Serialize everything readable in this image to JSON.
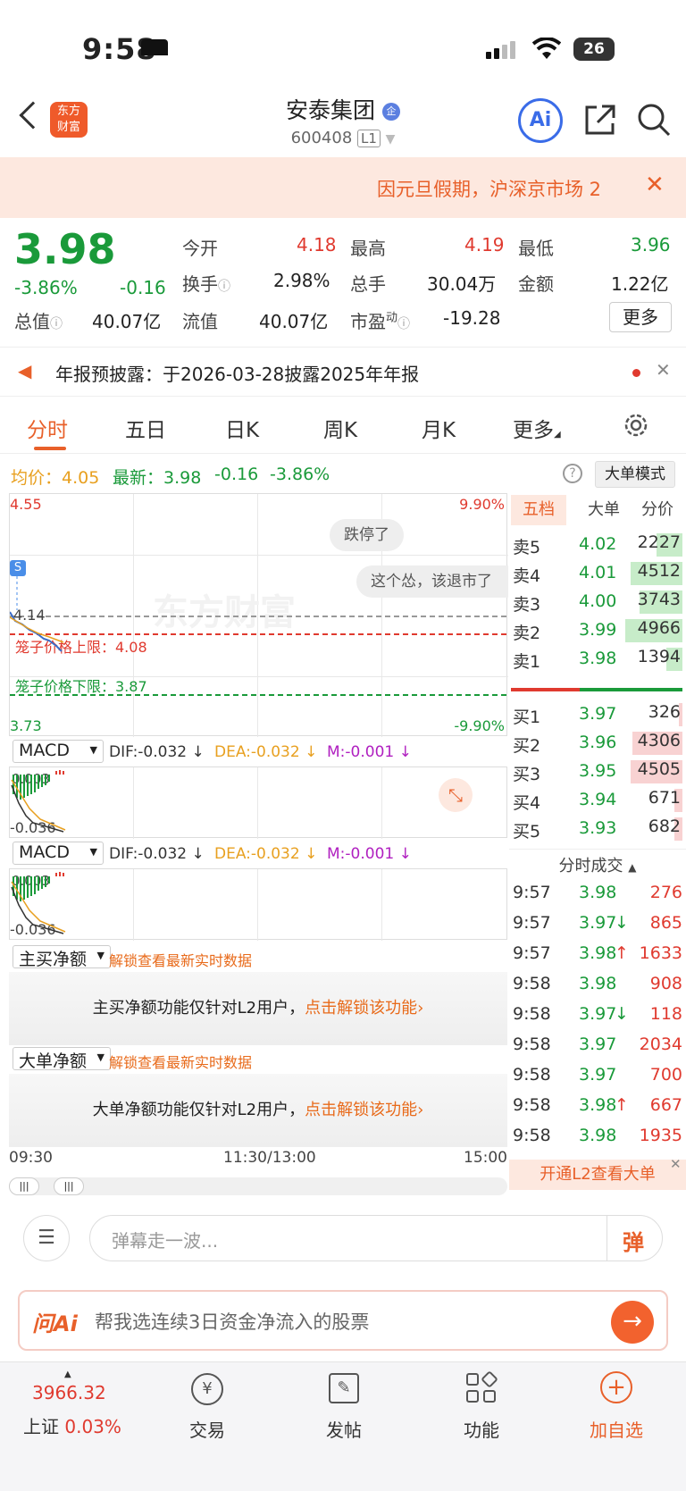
{
  "status": {
    "time": "9:58",
    "battery": "26"
  },
  "header": {
    "logo": "东方\n财富",
    "title": "安泰集团",
    "badge": "企",
    "code": "600408",
    "level": "L1",
    "ai_label": "Ai"
  },
  "notice": {
    "text": "因元旦假期，沪深京市场 2"
  },
  "quote": {
    "price": "3.98",
    "pct": "-3.86%",
    "chg": "-0.16",
    "open_label": "今开",
    "open": "4.18",
    "high_label": "最高",
    "high": "4.19",
    "low_label": "最低",
    "low": "3.96",
    "turn_label": "换手",
    "turn": "2.98%",
    "vol_label": "总手",
    "vol": "30.04万",
    "amt_label": "金额",
    "amt": "1.22亿",
    "mcap_label": "总值",
    "mcap": "40.07亿",
    "fcap_label": "流值",
    "fcap": "40.07亿",
    "pe_label": "市盈",
    "pe_sup": "动",
    "pe": "-19.28",
    "more": "更多"
  },
  "announce": {
    "text": "年报预披露：于2026-03-28披露2025年年报"
  },
  "tabs": [
    "分时",
    "五日",
    "日K",
    "周K",
    "月K",
    "更多"
  ],
  "avgline": {
    "avg_label": "均价：",
    "avg": "4.05",
    "last_label": "最新：",
    "last": "3.98",
    "chg": "-0.16",
    "pct": "-3.86%",
    "mode": "大单模式"
  },
  "chart": {
    "top": "4.55",
    "bottom": "3.73",
    "top_pct": "9.90%",
    "bottom_pct": "-9.90%",
    "ref": "4.14",
    "upper_label": "笼子价格上限：4.08",
    "lower_label": "笼子价格下限：3.87",
    "bubble1": "跌停了",
    "bubble2": "这个怂，该退市了",
    "s_mark": "S",
    "watermark": "东方财富",
    "x_labels": [
      "09:30",
      "11:30/13:00",
      "15:00"
    ]
  },
  "macd": {
    "name": "MACD",
    "dif": "DIF:-0.032 ↓",
    "dea": "DEA:-0.032 ↓",
    "m": "M:-0.001 ↓",
    "low": "-0.036",
    "hi": "0.003"
  },
  "lock1": {
    "sel": "主买净额",
    "hint": "解锁查看最新实时数据",
    "text": "主买净额功能仅针对L2用户，",
    "link": "点击解锁该功能"
  },
  "lock2": {
    "sel": "大单净额",
    "hint": "解锁查看最新实时数据",
    "text": "大单净额功能仅针对L2用户，",
    "link": "点击解锁该功能"
  },
  "side_tabs": [
    "五档",
    "大单",
    "分价"
  ],
  "sells": [
    {
      "l": "卖5",
      "p": "4.02",
      "v": "2227",
      "w": 0.45
    },
    {
      "l": "卖4",
      "p": "4.01",
      "v": "4512",
      "w": 0.9
    },
    {
      "l": "卖3",
      "p": "4.00",
      "v": "3743",
      "w": 0.75
    },
    {
      "l": "卖2",
      "p": "3.99",
      "v": "4966",
      "w": 1.0
    },
    {
      "l": "卖1",
      "p": "3.98",
      "v": "1394",
      "w": 0.28
    }
  ],
  "buys": [
    {
      "l": "买1",
      "p": "3.97",
      "v": "326",
      "w": 0.07
    },
    {
      "l": "买2",
      "p": "3.96",
      "v": "4306",
      "w": 0.87
    },
    {
      "l": "买3",
      "p": "3.95",
      "v": "4505",
      "w": 0.91
    },
    {
      "l": "买4",
      "p": "3.94",
      "v": "671",
      "w": 0.14
    },
    {
      "l": "买5",
      "p": "3.93",
      "v": "682",
      "w": 0.14
    }
  ],
  "trades_title": "分时成交",
  "trades": [
    {
      "t": "9:57",
      "p": "3.98",
      "a": "",
      "v": "276"
    },
    {
      "t": "9:57",
      "p": "3.97",
      "a": "↓",
      "v": "865"
    },
    {
      "t": "9:57",
      "p": "3.98",
      "a": "↑",
      "v": "1633"
    },
    {
      "t": "9:58",
      "p": "3.98",
      "a": "",
      "v": "908"
    },
    {
      "t": "9:58",
      "p": "3.97",
      "a": "↓",
      "v": "118"
    },
    {
      "t": "9:58",
      "p": "3.97",
      "a": "",
      "v": "2034"
    },
    {
      "t": "9:58",
      "p": "3.97",
      "a": "",
      "v": "700"
    },
    {
      "t": "9:58",
      "p": "3.98",
      "a": "↑",
      "v": "667"
    },
    {
      "t": "9:58",
      "p": "3.98",
      "a": "",
      "v": "1935"
    }
  ],
  "l2_banner": "开通L2查看大单",
  "danmu": {
    "placeholder": "弹幕走一波...",
    "btn": "弹"
  },
  "ai": {
    "logo": "问Ai",
    "text": "帮我选连续3日资金净流入的股票"
  },
  "nav": {
    "index_value": "3966.32",
    "index_name": "上证",
    "index_pct": "0.03%",
    "trade": "交易",
    "post": "发帖",
    "func": "功能",
    "add": "加自选"
  }
}
